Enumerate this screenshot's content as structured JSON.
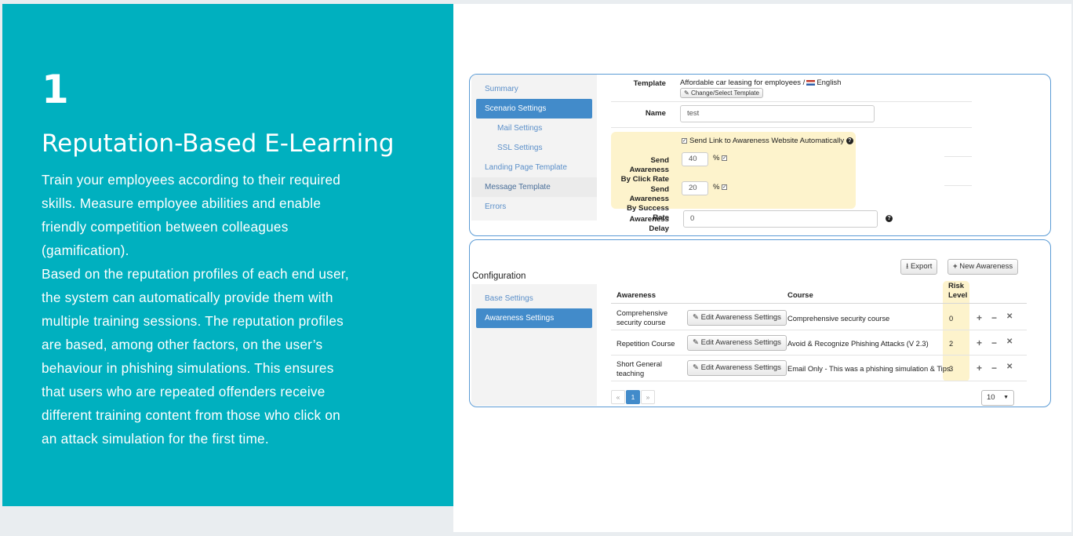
{
  "promo": {
    "number": "1",
    "heading": "Reputation-Based E-Learning",
    "lines": [
      "Train your employees according to their required",
      "skills. Measure employee abilities and enable",
      "friendly competition between colleagues",
      "(gamification).",
      "Based on the reputation profiles of each end user,",
      "the system can automatically provide them with",
      "multiple training sessions. The reputation profiles",
      "are based, among other factors, on the user’s",
      "behaviour in phishing simulations. This ensures",
      "that users who are repeated offenders receive",
      "different training content from those who click on",
      "an attack simulation for the first time."
    ]
  },
  "scenario": {
    "sidebar": [
      "Summary",
      "Scenario Settings",
      "Mail Settings",
      "SSL Settings",
      "Landing Page Template",
      "Message Template",
      "Errors"
    ],
    "template_label": "Template",
    "template_value": "Affordable car leasing for employees /",
    "template_lang": "English",
    "change_template_button": "Change/Select Template",
    "name_label": "Name",
    "name_value": "test",
    "send_link_label": "Send Link to Awareness Website Automatically",
    "click_rate_label_1": "Send Awareness",
    "click_rate_label_2": "By Click Rate",
    "click_rate_value": "40",
    "success_rate_label_1": "Send Awareness",
    "success_rate_label_2": "By Success Rate",
    "success_rate_value": "20",
    "percent": "%",
    "delay_label": "Awareness Delay",
    "delay_value": "0"
  },
  "config": {
    "title": "Configuration",
    "sidebar": [
      "Base Settings",
      "Awareness Settings"
    ],
    "export_button": "Export",
    "new_button": "New Awareness",
    "columns": {
      "awareness": "Awareness",
      "course": "Course",
      "risk_1": "Risk",
      "risk_2": "Level"
    },
    "edit_label": "Edit Awareness Settings",
    "rows": [
      {
        "name_1": "Comprehensive",
        "name_2": "security course",
        "course": "Comprehensive security course",
        "risk": "0"
      },
      {
        "name_1": "Repetition Course",
        "name_2": "",
        "course": "Avoid & Recognize Phishing Attacks (V 2.3)",
        "risk": "2"
      },
      {
        "name_1": "Short General",
        "name_2": "teaching",
        "course": "Email Only - This was a phishing simulation & Tips",
        "risk": "3"
      }
    ],
    "pager": {
      "prev": "«",
      "page": "1",
      "next": "»"
    },
    "page_size": "10",
    "colors": {
      "accent": "#428bca",
      "highlight": "#fdf3cc",
      "teal": "#00b0bf"
    }
  }
}
